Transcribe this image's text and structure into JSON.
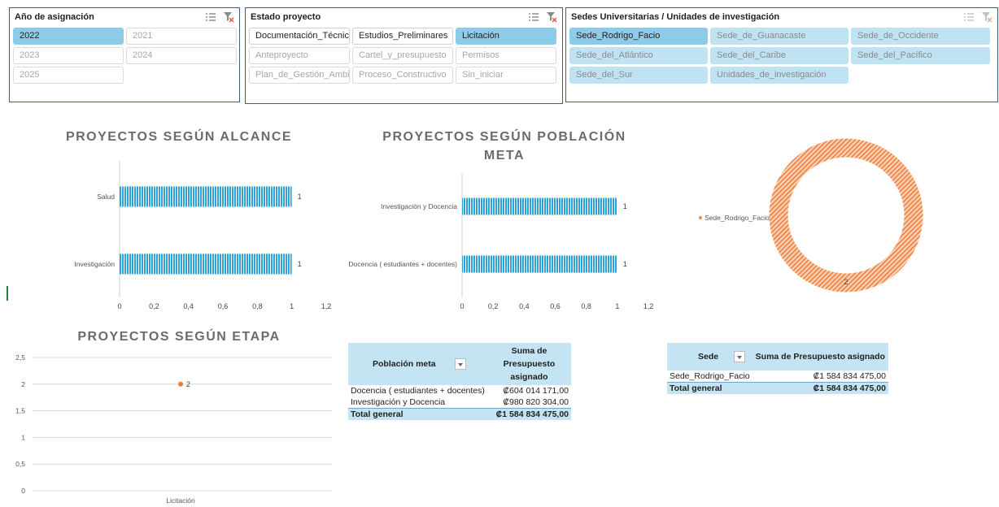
{
  "slicers": {
    "year": {
      "title": "Año de asignación",
      "items": [
        {
          "label": "2022",
          "state": "sel"
        },
        {
          "label": "2021",
          "state": "off"
        },
        {
          "label": "2023",
          "state": "off"
        },
        {
          "label": "2024",
          "state": "off"
        },
        {
          "label": "2025",
          "state": "off"
        }
      ]
    },
    "estado": {
      "title": "Estado proyecto",
      "items": [
        {
          "label": "Documentación_Técnica",
          "state": "avail"
        },
        {
          "label": "Estudios_Preliminares",
          "state": "avail"
        },
        {
          "label": "Licitación",
          "state": "sel"
        },
        {
          "label": "Anteproyecto",
          "state": "off"
        },
        {
          "label": "Cartel_y_presupuesto",
          "state": "off"
        },
        {
          "label": "Permisos",
          "state": "off"
        },
        {
          "label": "Plan_de_Gestión_Ambi...",
          "state": "off"
        },
        {
          "label": "Proceso_Constructivo",
          "state": "off"
        },
        {
          "label": "Sin_iniciar",
          "state": "off"
        }
      ]
    },
    "sedes": {
      "title": "Sedes Universitarias / Unidades de investigación",
      "items": [
        {
          "label": "Sede_Rodrigo_Facio",
          "state": "sel"
        },
        {
          "label": "Sede_de_Guanacaste",
          "state": "dim"
        },
        {
          "label": "Sede_de_Occidente",
          "state": "dim"
        },
        {
          "label": "Sede_del_Atlántico",
          "state": "dim"
        },
        {
          "label": "Sede_del_Caribe",
          "state": "dim"
        },
        {
          "label": "Sede_del_Pacífico",
          "state": "dim"
        },
        {
          "label": "Sede_del_Sur",
          "state": "dim"
        },
        {
          "label": "Unidades_de_investigación",
          "state": "dim"
        }
      ]
    }
  },
  "charts": {
    "alcance_title": "PROYECTOS SEGÚN ALCANCE",
    "poblacion_title_line1": "PROYECTOS SEGÚN POBLACIÓN",
    "poblacion_title_line2": "META",
    "etapa_title": "PROYECTOS SEGÚN ETAPA"
  },
  "chart_data": [
    {
      "type": "bar",
      "orientation": "horizontal",
      "title": "PROYECTOS SEGÚN ALCANCE",
      "categories": [
        "Salud",
        "Investigación"
      ],
      "values": [
        1,
        1
      ],
      "data_labels": [
        "1",
        "1"
      ],
      "xlim": [
        0,
        1.2
      ],
      "xticks": [
        "0",
        "0,2",
        "0,4",
        "0,6",
        "0,8",
        "1",
        "1,2"
      ],
      "color": "#2ea3d8",
      "grid": false
    },
    {
      "type": "bar",
      "orientation": "horizontal",
      "title": "PROYECTOS SEGÚN POBLACIÓN META",
      "categories": [
        "Investigación y Docencia",
        "Docencia ( estudiantes + docentes)"
      ],
      "values": [
        1,
        1
      ],
      "data_labels": [
        "1",
        "1"
      ],
      "xlim": [
        0,
        1.2
      ],
      "xticks": [
        "0",
        "0,2",
        "0,4",
        "0,6",
        "0,8",
        "1",
        "1,2"
      ],
      "color": "#2ea3d8",
      "grid": false
    },
    {
      "type": "pie",
      "style": "doughnut",
      "categories": [
        "Sede_Rodrigo_Facio"
      ],
      "values": [
        2
      ],
      "data_labels": [
        "2"
      ],
      "color": "#f08a4b",
      "legend": "left"
    },
    {
      "type": "line",
      "title": "PROYECTOS SEGÚN ETAPA",
      "categories": [
        "Licitación"
      ],
      "values": [
        2
      ],
      "data_labels": [
        "2"
      ],
      "ylim": [
        0,
        2.5
      ],
      "yticks": [
        "0",
        "0,5",
        "1",
        "1,5",
        "2",
        "2,5"
      ],
      "color": "#f07c3a",
      "grid": true
    }
  ],
  "tables": {
    "poblacion": {
      "col1": "Población meta",
      "col2": "Suma de Presupuesto asignado",
      "rows": [
        {
          "label": "Docencia ( estudiantes + docentes)",
          "value": "₡604 014 171,00"
        },
        {
          "label": "Investigación y Docencia",
          "value": "₡980 820 304,00"
        }
      ],
      "total_label": "Total general",
      "total_value": "₡1 584 834 475,00"
    },
    "sede": {
      "col1": "Sede",
      "col2": "Suma de Presupuesto asignado",
      "rows": [
        {
          "label": "Sede_Rodrigo_Facio",
          "value": "₡1 584 834 475,00"
        }
      ],
      "total_label": "Total general",
      "total_value": "₡1 584 834 475,00"
    }
  },
  "colors": {
    "slicer_selected": "#8ecbe8",
    "slicer_dim": "#bfe3f2",
    "bar": "#2ea3d8",
    "donut": "#f08a4b",
    "table_header": "#c5e4f3"
  }
}
